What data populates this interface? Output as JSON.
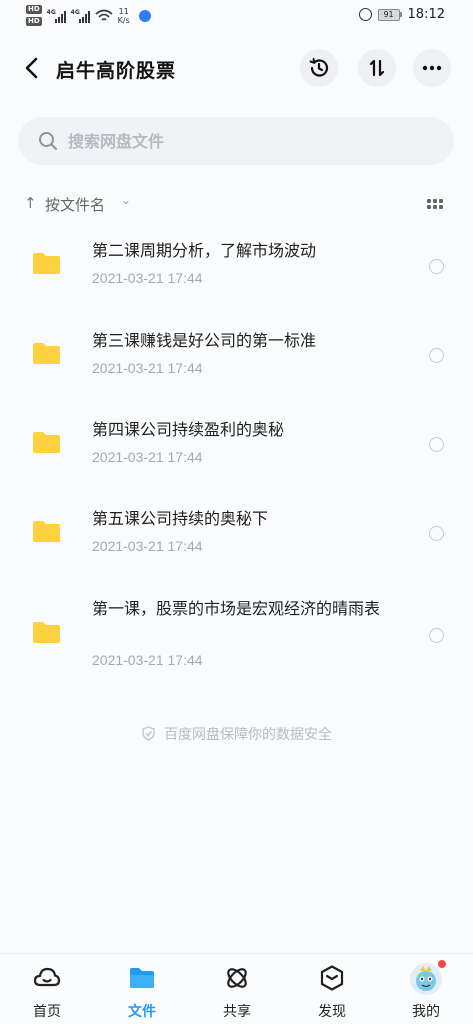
{
  "status_bar": {
    "hd_top": "HD",
    "hd_bottom": "HD",
    "signal1_tag": "4G",
    "signal2_tag": "4G",
    "net_speed_value": "11",
    "net_speed_unit": "K/s",
    "battery": "91",
    "time": "18:12"
  },
  "header": {
    "title": "启牛高阶股票"
  },
  "search": {
    "placeholder": "搜索网盘文件"
  },
  "sort": {
    "label": "按文件名"
  },
  "files": [
    {
      "name": "第二课周期分析，了解市场波动",
      "date": "2021-03-21  17:44"
    },
    {
      "name": "第三课赚钱是好公司的第一标准",
      "date": "2021-03-21  17:44"
    },
    {
      "name": "第四课公司持续盈利的奥秘",
      "date": "2021-03-21  17:44"
    },
    {
      "name": "第五课公司持续的奥秘下",
      "date": "2021-03-21  17:44"
    },
    {
      "name": "第一课，股票的市场是宏观经济的晴雨表",
      "date": "2021-03-21  17:44"
    }
  ],
  "footer_note": "百度网盘保障你的数据安全",
  "nav": {
    "items": [
      {
        "label": "首页",
        "icon": "home-cloud-icon"
      },
      {
        "label": "文件",
        "icon": "folder-icon"
      },
      {
        "label": "共享",
        "icon": "share-icon"
      },
      {
        "label": "发现",
        "icon": "discover-icon"
      },
      {
        "label": "我的",
        "icon": "avatar"
      }
    ],
    "active": "文件"
  },
  "colors": {
    "accent": "#1e9cf3",
    "folder": "#fdd140",
    "badge": "#f04848"
  }
}
